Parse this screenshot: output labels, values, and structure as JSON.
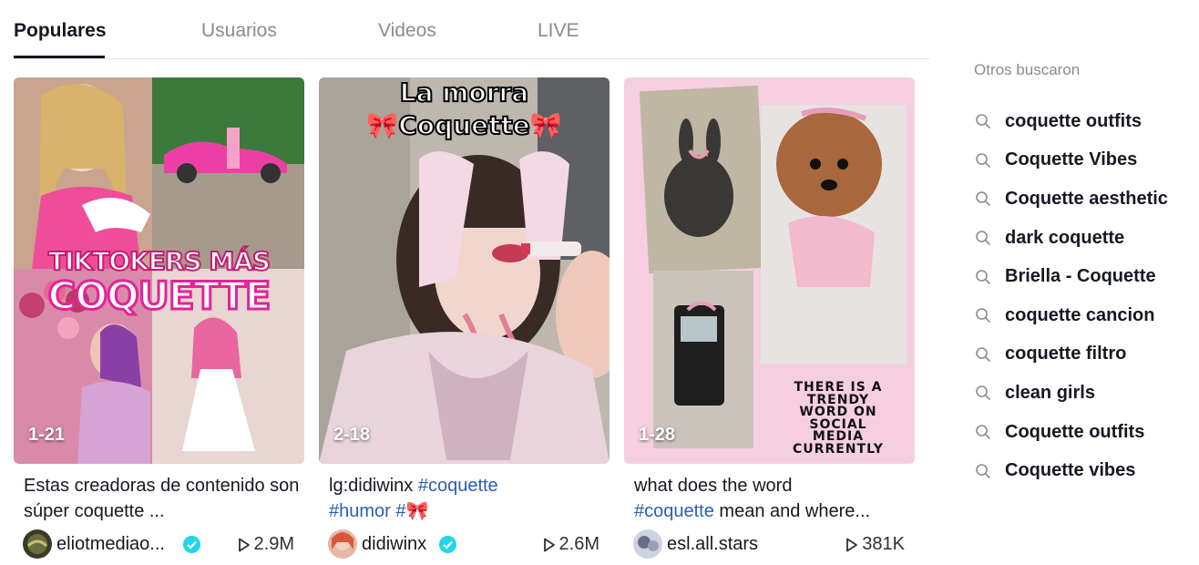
{
  "tabs": [
    "Populares",
    "Usuarios",
    "Videos",
    "LIVE"
  ],
  "cards": [
    {
      "count": "1-21",
      "overlay": [
        "TIKTOKERS MÁS",
        "COQUETTE"
      ],
      "caption_text": "Estas creadoras de contenido son súper coquette ...",
      "username": "eliotmediao...",
      "verified": true,
      "views": "2.9M"
    },
    {
      "count": "2-18",
      "overlay": [
        "La morra",
        "🎀Coquette🎀"
      ],
      "caption_prefix": "lg:didiwinx ",
      "caption_tag1": "#coquette",
      "caption_tag2": "#humor",
      "caption_tag3": "#🎀",
      "username": "didiwinx",
      "verified": true,
      "views": "2.6M"
    },
    {
      "count": "1-28",
      "overlay": [
        "THERE IS A",
        "TRENDY",
        "WORD ON",
        "SOCIAL",
        "MEDIA",
        "CURRENTLY"
      ],
      "caption_line1": "what does the word",
      "caption_tag": "#coquette",
      "caption_rest": " mean and where...",
      "username": "esl.all.stars",
      "verified": false,
      "views": "381K"
    }
  ],
  "sidebar": {
    "title": "Otros buscaron",
    "items": [
      "coquette outfits",
      "Coquette Vibes",
      "Coquette aesthetic",
      "dark coquette",
      "Briella - Coquette",
      "coquette cancion",
      "coquette filtro",
      "clean girls",
      "Coquette outfits",
      "Coquette vibes"
    ]
  },
  "colors": {
    "hashtag": "#2b5db9",
    "verified": "#20d5ec",
    "muted": "#8a8b91"
  }
}
